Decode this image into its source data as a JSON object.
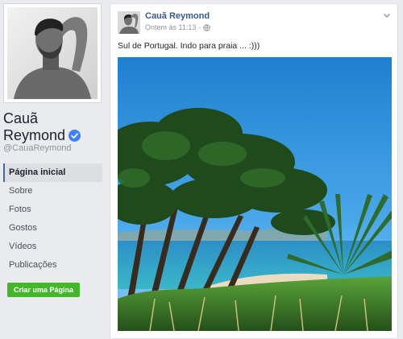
{
  "profile": {
    "name_line1": "Cauã",
    "name_line2": "Reymond",
    "handle": "@CauaReymond",
    "verified_icon": "verified-check-icon",
    "verified_color": "#4080ff"
  },
  "nav": {
    "items": [
      {
        "label": "Página inicial",
        "active": true
      },
      {
        "label": "Sobre"
      },
      {
        "label": "Fotos"
      },
      {
        "label": "Gostos"
      },
      {
        "label": "Vídeos"
      },
      {
        "label": "Publicações"
      }
    ],
    "active_color": "#4267b2"
  },
  "create_page_button": {
    "label": "Criar uma Página",
    "color": "#42b72a"
  },
  "post": {
    "author": "Cauã Reymond",
    "timestamp": "Ontem às 11:13",
    "separator": "·",
    "privacy_icon": "globe-icon",
    "menu_icon": "chevron-down-icon",
    "text": "Sul de Portugal. Indo para praia ... :)))"
  },
  "colors": {
    "background": "#e9ebee",
    "link": "#365899"
  }
}
